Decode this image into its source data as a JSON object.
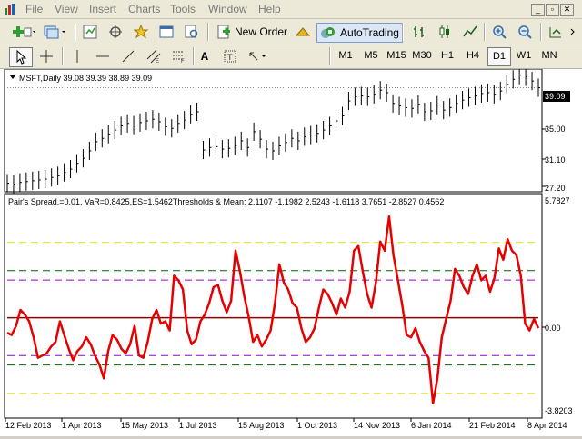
{
  "menu": {
    "items": [
      "File",
      "View",
      "Insert",
      "Charts",
      "Tools",
      "Window",
      "Help"
    ]
  },
  "toolbar": {
    "new_order_label": "New Order",
    "autotrading_label": "AutoTrading"
  },
  "timeframes": [
    "M1",
    "M5",
    "M15",
    "M30",
    "H1",
    "H4",
    "D1",
    "W1",
    "MN"
  ],
  "active_timeframe": "D1",
  "price_panel": {
    "header": "MSFT,Daily  39.08 39.39 38.89 39.09",
    "current_price": "39.09",
    "y_ticks": [
      "35.00",
      "31.10",
      "27.20"
    ],
    "y_range": [
      26.9,
      40.9
    ]
  },
  "indicator_panel": {
    "header": "Pair's Spread.=0.01, VaR=0.8425,ES=1.5462Thresholds & Mean: 2.1107 -1.1982 2.5243 -1.6118 3.7651 -2.8527 0.4562",
    "y_max_label": "5.7827",
    "y_zero_label": "0.00",
    "y_min_label": "-3.8203",
    "y_range": [
      -3.8203,
      5.7827
    ],
    "levels": [
      {
        "name": "mean",
        "value": 0.4562,
        "color": "#8b0000",
        "style": "solid"
      },
      {
        "name": "upper-1",
        "value": 2.1107,
        "color": "#9400d3",
        "style": "dashed"
      },
      {
        "name": "lower-1",
        "value": -1.1982,
        "color": "#9400d3",
        "style": "dashed"
      },
      {
        "name": "upper-2",
        "value": 2.5243,
        "color": "#006400",
        "style": "dashed"
      },
      {
        "name": "lower-2",
        "value": -1.6118,
        "color": "#006400",
        "style": "dashed"
      },
      {
        "name": "upper-3",
        "value": 3.7651,
        "color": "#e6e600",
        "style": "dashed"
      },
      {
        "name": "lower-3",
        "value": -2.8527,
        "color": "#e6e600",
        "style": "dashed"
      }
    ],
    "line_color": "#e60000"
  },
  "x_axis": {
    "labels": [
      "12 Feb 2013",
      "1 Apr 2013",
      "15 May 2013",
      "1 Jul 2013",
      "15 Aug 2013",
      "1 Oct 2013",
      "14 Nov 2013",
      "6 Jan 2014",
      "21 Feb 2014",
      "8 Apr 2014"
    ]
  },
  "chart_data": [
    {
      "type": "line",
      "title": "MSFT,Daily",
      "series": [
        {
          "name": "MSFT",
          "values": [
            27.6,
            27.5,
            27.7,
            27.8,
            27.9,
            28.0,
            28.1,
            28.3,
            28.5,
            28.9,
            29.3,
            30.0,
            30.6,
            31.5,
            32.6,
            33.0,
            33.5,
            34.0,
            34.5,
            34.8,
            34.6,
            34.9,
            35.1,
            35.3,
            35.0,
            34.4,
            34.2,
            34.8,
            35.2,
            35.9,
            36.2,
            31.6,
            31.9,
            32.0,
            31.7,
            31.8,
            32.1,
            32.7,
            31.9,
            33.8,
            32.9,
            31.7,
            31.5,
            32.1,
            32.5,
            33.0,
            32.7,
            33.2,
            33.4,
            33.6,
            34.0,
            34.5,
            35.1,
            35.7,
            37.5,
            38.0,
            38.1,
            38.0,
            38.3,
            38.8,
            38.5,
            37.2,
            36.9,
            36.7,
            36.6,
            37.1,
            36.2,
            36.3,
            37.0,
            36.4,
            36.7,
            37.2,
            37.6,
            37.9,
            38.1,
            38.4,
            38.5,
            38.3,
            38.7,
            39.5,
            40.1,
            40.6,
            40.4,
            39.9,
            39.09
          ]
        }
      ]
    },
    {
      "type": "line",
      "title": "Pair's Spread",
      "series": [
        {
          "name": "Pair's Spread",
          "values": [
            -0.2,
            -0.3,
            0.1,
            0.8,
            0.6,
            0.3,
            -0.4,
            -1.3,
            -1.2,
            -1.1,
            -0.8,
            -0.6,
            0.3,
            -0.3,
            -0.9,
            -1.4,
            -1.0,
            -0.8,
            -0.4,
            -0.7,
            -1.2,
            -1.6,
            -2.2,
            -1.0,
            -0.3,
            -0.5,
            -0.9,
            -1.1,
            -0.7,
            0.1,
            -1.2,
            -1.3,
            -0.6,
            0.4,
            0.8,
            0.2,
            0.3,
            -0.1,
            2.3,
            2.1,
            1.7,
            -0.1,
            -0.7,
            -0.5,
            0.3,
            0.6,
            1.1,
            1.8,
            1.9,
            1.2,
            0.7,
            1.2,
            3.4,
            2.5,
            1.4,
            0.5,
            -0.6,
            -0.3,
            -0.8,
            -0.5,
            -0.1,
            1.1,
            2.8,
            2.0,
            1.7,
            1.1,
            0.9,
            0.0,
            -0.6,
            -0.4,
            0.0,
            0.9,
            1.7,
            1.5,
            1.1,
            0.6,
            1.3,
            0.9,
            1.6,
            3.4,
            3.6,
            2.5,
            1.5,
            0.9,
            2.0,
            3.8,
            3.4,
            4.9,
            3.2,
            2.1,
            1.0,
            -0.3,
            -0.4,
            0.0,
            -0.6,
            -1.0,
            -1.3,
            -3.3,
            -2.2,
            -0.4,
            0.4,
            1.2,
            2.6,
            2.3,
            1.8,
            1.5,
            2.3,
            2.8,
            2.1,
            2.3,
            1.6,
            2.2,
            3.5,
            3.0,
            3.9,
            3.4,
            3.2,
            2.3,
            0.2,
            -0.1,
            0.4,
            0.0
          ]
        }
      ]
    }
  ]
}
